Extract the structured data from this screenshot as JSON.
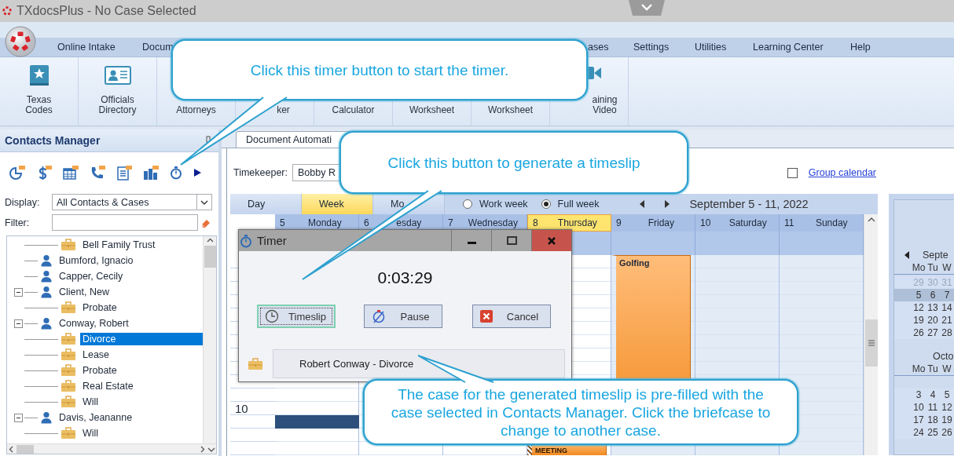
{
  "window": {
    "title": "TXdocsPlus - No Case Selected"
  },
  "menu": [
    {
      "label": "Online Intake"
    },
    {
      "label": "Docum"
    },
    {
      "label": "ases"
    },
    {
      "label": "Settings"
    },
    {
      "label": "Utilities"
    },
    {
      "label": "Learning Center"
    },
    {
      "label": "Help"
    }
  ],
  "ribbon": [
    {
      "label": "Texas\nCodes"
    },
    {
      "label": "Officials\nDirectory"
    },
    {
      "label": "Attorneys"
    },
    {
      "label": "ker"
    },
    {
      "label": "Calculator"
    },
    {
      "label": "Worksheet"
    },
    {
      "label": "Worksheet"
    },
    {
      "label": "aining\nVideo"
    }
  ],
  "contacts_manager": {
    "title": "Contacts Manager",
    "display": {
      "label": "Display:",
      "value": "All Contacts & Cases"
    },
    "filter": {
      "label": "Filter:"
    },
    "tree": [
      {
        "label": "Bell Family Trust",
        "kind": "case",
        "selected": false
      },
      {
        "label": "Bumford, Ignacio",
        "kind": "contact",
        "selected": false
      },
      {
        "label": "Capper, Cecily",
        "kind": "contact",
        "selected": false
      },
      {
        "label": "Client, New",
        "kind": "contact",
        "selected": false,
        "expanded": true,
        "children": [
          {
            "label": "Probate",
            "kind": "case",
            "selected": false
          }
        ]
      },
      {
        "label": "Conway, Robert",
        "kind": "contact",
        "selected": false,
        "expanded": true,
        "children": [
          {
            "label": "Divorce",
            "kind": "case",
            "selected": true
          },
          {
            "label": "Lease",
            "kind": "case",
            "selected": false
          },
          {
            "label": "Probate",
            "kind": "case",
            "selected": false
          },
          {
            "label": "Real Estate",
            "kind": "case",
            "selected": false
          },
          {
            "label": "Will",
            "kind": "case",
            "selected": false
          }
        ]
      },
      {
        "label": "Davis, Jeananne",
        "kind": "contact",
        "selected": false,
        "expanded": true,
        "children": [
          {
            "label": "Will",
            "kind": "case",
            "selected": false
          }
        ]
      }
    ]
  },
  "document_tab": {
    "label": "Document Automati"
  },
  "timekeeper": {
    "label": "Timekeeper:",
    "value": "Bobby R"
  },
  "group_calendar": {
    "label": "Group calendar",
    "checked": false
  },
  "calendar": {
    "views": [
      {
        "label": "Day",
        "selected": false
      },
      {
        "label": "Week",
        "selected": true
      },
      {
        "label": "Mo",
        "selected": false
      }
    ],
    "week_modes": [
      {
        "label": "Work week",
        "selected": false
      },
      {
        "label": "Full week",
        "selected": true
      }
    ],
    "range": "September 5 - 11, 2022",
    "hour_label": "10",
    "days": [
      {
        "number": "5",
        "name": "Monday",
        "selected": false,
        "working_day": true,
        "appointments": [
          {
            "kind": "busy"
          }
        ]
      },
      {
        "number": "6",
        "name": "esday",
        "selected": false,
        "working_day": true
      },
      {
        "number": "7",
        "name": "Wednesday",
        "selected": false,
        "working_day": true
      },
      {
        "number": "8",
        "name": "Thursday",
        "selected": true,
        "working_day": true,
        "appointments": [
          {
            "kind": "event",
            "title": "MEETING"
          }
        ]
      },
      {
        "number": "9",
        "name": "Friday",
        "selected": false,
        "working_day": false,
        "appointments": [
          {
            "kind": "event",
            "title": "Golfing"
          }
        ]
      },
      {
        "number": "10",
        "name": "Saturday",
        "selected": false,
        "working_day": false
      },
      {
        "number": "11",
        "name": "Sunday",
        "selected": false,
        "working_day": false
      }
    ]
  },
  "mini_calendar": {
    "months": [
      {
        "title": "Septe",
        "weekdays": [
          "Mo",
          "Tu",
          "W"
        ],
        "weeks": [
          {
            "days": [
              "29",
              "30",
              "31"
            ],
            "other_month": true,
            "selected": false
          },
          {
            "days": [
              "5",
              "6",
              "7"
            ],
            "other_month": false,
            "selected": true
          },
          {
            "days": [
              "12",
              "13",
              "14"
            ],
            "other_month": false,
            "selected": false
          },
          {
            "days": [
              "19",
              "20",
              "21"
            ],
            "other_month": false,
            "selected": false
          },
          {
            "days": [
              "26",
              "27",
              "28"
            ],
            "other_month": false,
            "selected": false
          }
        ]
      },
      {
        "title": "Octo",
        "weekdays": [
          "Mo",
          "Tu",
          "W"
        ],
        "weeks": [
          {
            "days": [
              "3",
              "4",
              "5"
            ],
            "other_month": false,
            "selected": false
          },
          {
            "days": [
              "10",
              "11",
              "12"
            ],
            "other_month": false,
            "selected": false
          },
          {
            "days": [
              "17",
              "18",
              "19"
            ],
            "other_month": false,
            "selected": false
          },
          {
            "days": [
              "24",
              "25",
              "26"
            ],
            "other_month": false,
            "selected": false
          }
        ]
      }
    ]
  },
  "timer": {
    "title": "Timer",
    "elapsed": "0:03:29",
    "buttons": [
      {
        "label": "Timeslip",
        "kind": "timeslip",
        "focused": true
      },
      {
        "label": "Pause",
        "kind": "pause",
        "focused": false
      },
      {
        "label": "Cancel",
        "kind": "cancel",
        "focused": false
      }
    ],
    "case": "Robert Conway - Divorce"
  },
  "callouts": [
    {
      "text": "Click this timer button to start the timer."
    },
    {
      "text": "Click this button to generate a timeslip"
    },
    {
      "text": "The case for the generated timeslip is pre-filled with the case selected in Contacts Manager.  Click the briefcase to change to another case."
    }
  ]
}
